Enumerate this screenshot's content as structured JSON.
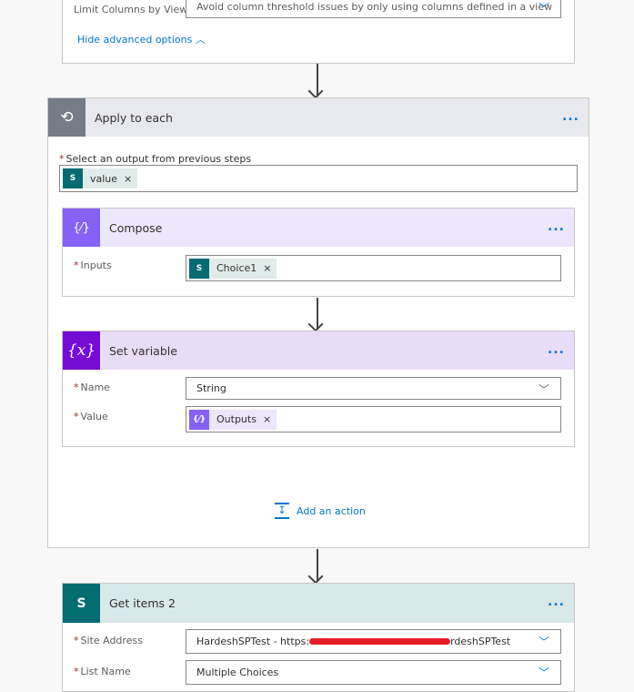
{
  "top_card": {
    "limit_label": "Limit Columns by View",
    "limit_value": "Avoid column threshold issues by only using columns defined in a view",
    "hide_advanced": "Hide advanced options"
  },
  "apply_each": {
    "title": "Apply to each",
    "select_label": "Select an output from previous steps",
    "token": "value",
    "color": "#757c86"
  },
  "compose": {
    "title": "Compose",
    "inputs_label": "Inputs",
    "token": "Choice1",
    "color": "#8661f5"
  },
  "set_variable": {
    "title": "Set variable",
    "name_label": "Name",
    "name_value": "String",
    "value_label": "Value",
    "value_token": "Outputs",
    "color": "#770bd6"
  },
  "add_action": "Add an action",
  "get_items": {
    "title": "Get items 2",
    "site_label": "Site Address",
    "site_value_start": "HardeshSPTest - https:",
    "site_value_end": "rdeshSPTest",
    "list_label": "List Name",
    "list_value": "Multiple Choices",
    "color": "#036c70"
  },
  "more_icon": "...",
  "remove": "×"
}
